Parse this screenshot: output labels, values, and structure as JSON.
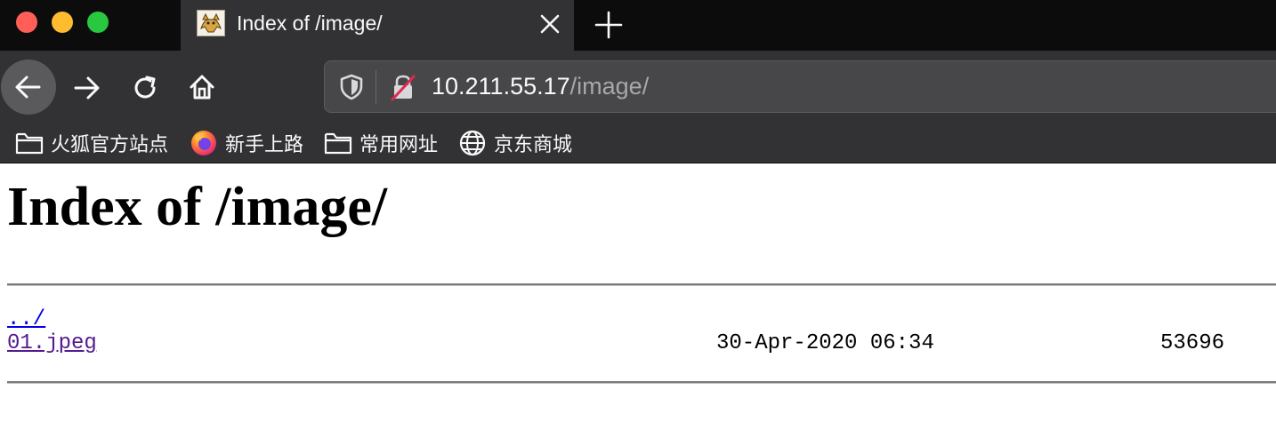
{
  "tab": {
    "title": "Index of /image/",
    "favicon": "tomcat-favicon-icon",
    "close_icon": "close-icon",
    "new_tab_icon": "plus-icon"
  },
  "nav": {
    "back_icon": "back-arrow-icon",
    "forward_icon": "forward-arrow-icon",
    "reload_icon": "reload-icon",
    "home_icon": "home-icon",
    "url_host": "10.211.55.17",
    "url_path": "/image/"
  },
  "bookmarks": [
    {
      "label": "火狐官方站点",
      "icon": "folder-icon"
    },
    {
      "label": "新手上路",
      "icon": "firefox-icon"
    },
    {
      "label": "常用网址",
      "icon": "folder-icon"
    },
    {
      "label": "京东商城",
      "icon": "globe-icon"
    }
  ],
  "page": {
    "heading": "Index of /image/",
    "entries": [
      {
        "name": "../",
        "date": "",
        "size": ""
      },
      {
        "name": "01.jpeg",
        "date": "30-Apr-2020 06:34",
        "size": "53696"
      }
    ]
  },
  "colors": {
    "chrome_dark": "#0c0c0d",
    "chrome": "#323234",
    "link": "#0000ee",
    "visited_link": "#551a8b"
  }
}
